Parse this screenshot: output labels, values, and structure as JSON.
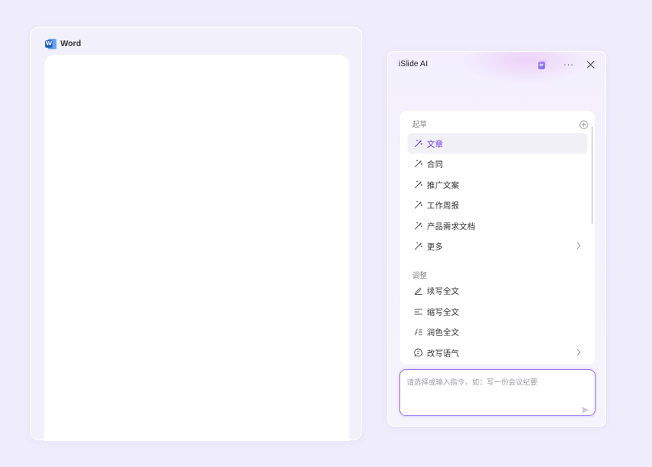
{
  "word": {
    "title": "Word",
    "logo_letter": "W"
  },
  "ai_panel": {
    "title": "iSlide AI",
    "more_label": "···",
    "sections": {
      "draft": {
        "label": "起草",
        "items": [
          {
            "label": "文章",
            "icon": "magic-wand-icon",
            "active": true
          },
          {
            "label": "合同",
            "icon": "magic-wand-icon"
          },
          {
            "label": "推广文案",
            "icon": "magic-wand-icon"
          },
          {
            "label": "工作周报",
            "icon": "magic-wand-icon"
          },
          {
            "label": "产品需求文档",
            "icon": "magic-wand-icon"
          },
          {
            "label": "更多",
            "icon": "magic-wand-icon",
            "has_submenu": true
          }
        ]
      },
      "adjust": {
        "label": "调整",
        "items": [
          {
            "label": "续写全文",
            "icon": "pen-icon"
          },
          {
            "label": "缩写全文",
            "icon": "shorten-lines-icon"
          },
          {
            "label": "润色全文",
            "icon": "polish-icon"
          },
          {
            "label": "改写语气",
            "icon": "chat-bubble-icon",
            "has_submenu": true
          }
        ]
      }
    },
    "prompt": {
      "placeholder": "请选择或输入指令，如：写一份会议纪要",
      "value": ""
    }
  },
  "colors": {
    "background": "#efedfb",
    "accent": "#6a3fe6",
    "prompt_border": "#9a78f0",
    "word_blue": "#185abd"
  }
}
